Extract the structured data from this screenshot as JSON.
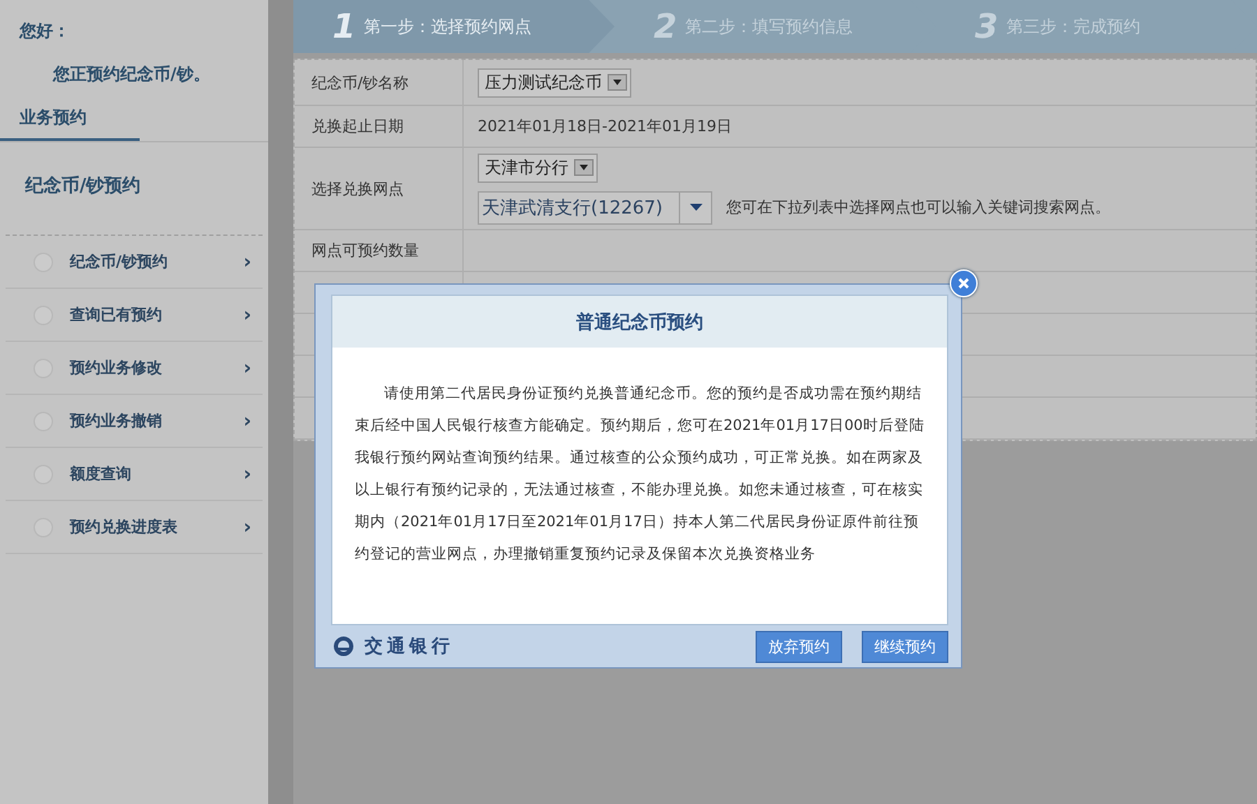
{
  "sidebar": {
    "greeting": "您好：",
    "message": "您正预约纪念币/钞。",
    "section_tab": "业务预约",
    "group_title": "纪念币/钞预约",
    "items": [
      {
        "label": "纪念币/钞预约",
        "arrow": "›"
      },
      {
        "label": "查询已有预约",
        "arrow": "›"
      },
      {
        "label": "预约业务修改",
        "arrow": "›"
      },
      {
        "label": "预约业务撤销",
        "arrow": "›"
      },
      {
        "label": "额度查询",
        "arrow": "›"
      },
      {
        "label": "预约兑换进度表",
        "arrow": "›"
      }
    ]
  },
  "steps": [
    {
      "number": "1",
      "label": "第一步：选择预约网点",
      "selected": true
    },
    {
      "number": "2",
      "label": "第二步：填写预约信息",
      "selected": false
    },
    {
      "number": "3",
      "label": "第三步：完成预约",
      "selected": false
    }
  ],
  "form": {
    "rows": [
      {
        "kind": "select",
        "label": "纪念币/钞名称",
        "value": "压力测试纪念币"
      },
      {
        "kind": "text",
        "label": "兑换起止日期",
        "value": "2021年01月18日-2021年01月19日"
      },
      {
        "kind": "branch",
        "label": "选择兑换网点",
        "city": "天津市分行",
        "branch": "天津武清支行(12267)",
        "hint": "您可在下拉列表中选择网点也可以输入关键词搜索网点。"
      },
      {
        "kind": "text",
        "label": "网点可预约数量",
        "value": ""
      },
      {
        "kind": "empty"
      },
      {
        "kind": "empty"
      },
      {
        "kind": "empty"
      },
      {
        "kind": "empty"
      }
    ]
  },
  "dialog": {
    "title": "普通纪念币预约",
    "paragraph": "请使用第二代居民身份证预约兑换普通纪念币。您的预约是否成功需在预约期结束后经中国人民银行核查方能确定。预约期后，您可在2021年01月17日00时后登陆我银行预约网站查询预约结果。通过核查的公众预约成功，可正常兑换。如在两家及以上银行有预约记录的，无法通过核查，不能办理兑换。如您未通过核查，可在核实期内（2021年01月17日至2021年01月17日）持本人第二代居民身份证原件前往预约登记的营业网点，办理撤销重复预约记录及保留本次兑换资格业务",
    "logo_text": "交通银行",
    "buttons": [
      "放弃预约",
      "继续预约"
    ]
  }
}
